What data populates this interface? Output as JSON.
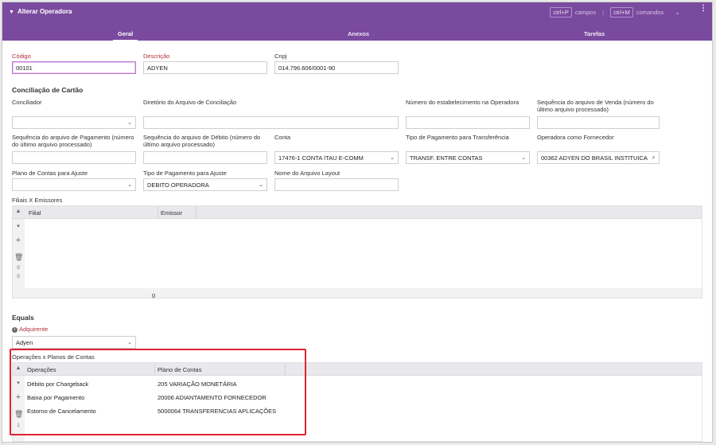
{
  "window": {
    "title": "Alterar Operadora",
    "shortcuts": {
      "key1": "ctrl+P",
      "label1": "campos",
      "sep": "|",
      "key2": "ctrl+M",
      "label2": "comandos"
    }
  },
  "tabs": [
    {
      "label": "Geral",
      "active": true
    },
    {
      "label": "Anexos",
      "active": false
    },
    {
      "label": "Tarefas",
      "active": false
    }
  ],
  "form": {
    "codigo": {
      "label": "Código",
      "value": "00101"
    },
    "descricao": {
      "label": "Descrição",
      "value": "ADYEN"
    },
    "cnpj": {
      "label": "Cnpj",
      "value": "014.796.606/0001-90"
    }
  },
  "conciliacao": {
    "section_title": "Conciliação de Cartão",
    "conciliador": {
      "label": "Conciliador",
      "value": ""
    },
    "diretorio": {
      "label": "Diretório do Arquivo de Conciliação",
      "value": ""
    },
    "num_estab": {
      "label": "Número do estabelecimento na Operadora",
      "value": ""
    },
    "seq_venda": {
      "label": "Sequência do arquivo de Venda (número do último arquivo processado)",
      "value": ""
    },
    "seq_pagamento": {
      "label": "Sequência do arquivo de Pagamento (número do último arquivo processado)",
      "value": ""
    },
    "seq_debito": {
      "label": "Sequência do arquivo de Débito (número do último arquivo processado)",
      "value": ""
    },
    "conta": {
      "label": "Conta",
      "value": "17476-1 CONTA ITAU E-COMM"
    },
    "tipo_pag_transf": {
      "label": "Tipo de Pagamento para Transferência",
      "value": "TRANSF. ENTRE CONTAS"
    },
    "operadora_fornecedor": {
      "label": "Operadora como Fornecedor",
      "value": "00362 ADYEN DO BRASIL INSTITUICA"
    },
    "plano_contas_ajuste": {
      "label": "Plano de Contas para Ajuste",
      "value": ""
    },
    "tipo_pag_ajuste": {
      "label": "Tipo de Pagamento para Ajuste",
      "value": "DEBITO OPERADORA"
    },
    "nome_layout": {
      "label": "Nome do Arquivo Layout",
      "value": ""
    }
  },
  "filiais_grid": {
    "title": "Filiais X Emissores",
    "columns": [
      "Filial",
      "Emissor"
    ],
    "count_a": "0",
    "count_b": "0",
    "footer_count": "0"
  },
  "equals": {
    "section_title": "Equals",
    "adquirente_label": "Adquirente",
    "adquirente_value": "Adyen"
  },
  "operacoes_grid": {
    "title": "Operações x Planos de Contas",
    "columns": [
      "Operações",
      "Plano de Contas"
    ],
    "rows": [
      {
        "operacao": "Débito por Chargeback",
        "plano": "205 VARIAÇÃO MONETÁRIA"
      },
      {
        "operacao": "Baixa por Pagamento",
        "plano": "20006 ADIANTAMENTO FORNECEDOR"
      },
      {
        "operacao": "Estorno de Cancelamento",
        "plano": "5000064 TRANSFERENCIAS APLICAÇÕES"
      }
    ],
    "count_a": "1"
  },
  "colors": {
    "accent": "#7a4a9e",
    "required": "#b0303a",
    "highlight": "#e0242f"
  }
}
